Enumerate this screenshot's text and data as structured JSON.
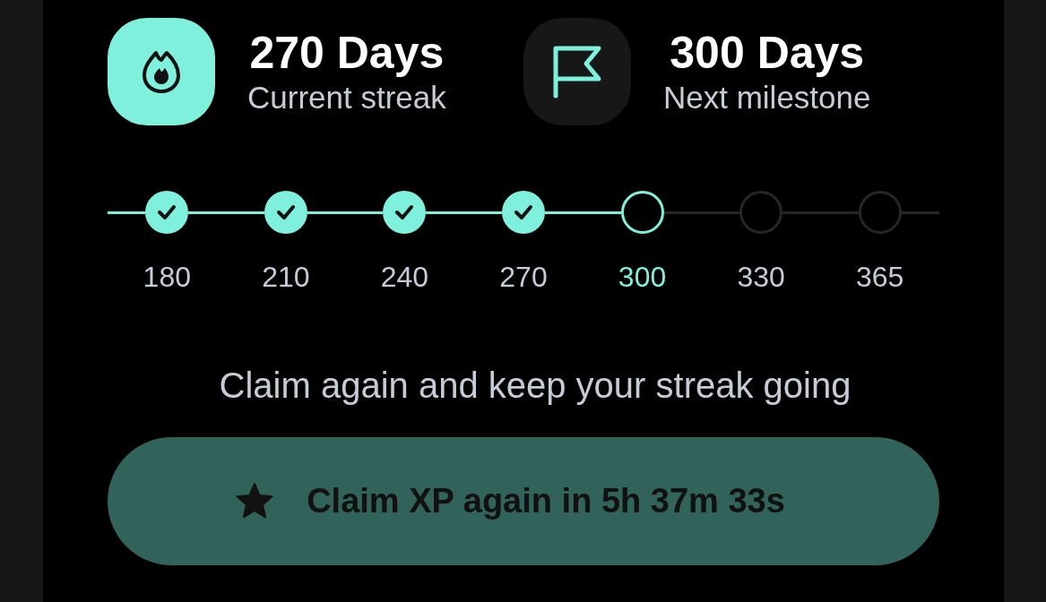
{
  "stats": [
    {
      "kind": "flame",
      "value": "270 Days",
      "label": "Current streak"
    },
    {
      "kind": "flag",
      "value": "300 Days",
      "label": "Next milestone"
    }
  ],
  "milestones": [
    {
      "label": "180",
      "checked": true,
      "selected": false
    },
    {
      "label": "210",
      "checked": true,
      "selected": false
    },
    {
      "label": "240",
      "checked": true,
      "selected": false
    },
    {
      "label": "270",
      "checked": true,
      "selected": false
    },
    {
      "label": "300",
      "checked": false,
      "selected": true
    },
    {
      "label": "330",
      "checked": false,
      "selected": false
    },
    {
      "label": "365",
      "checked": false,
      "selected": false
    }
  ],
  "message": "Claim again and keep your streak going",
  "claim_button": {
    "label": "Claim XP again in 5h 37m 33s"
  }
}
